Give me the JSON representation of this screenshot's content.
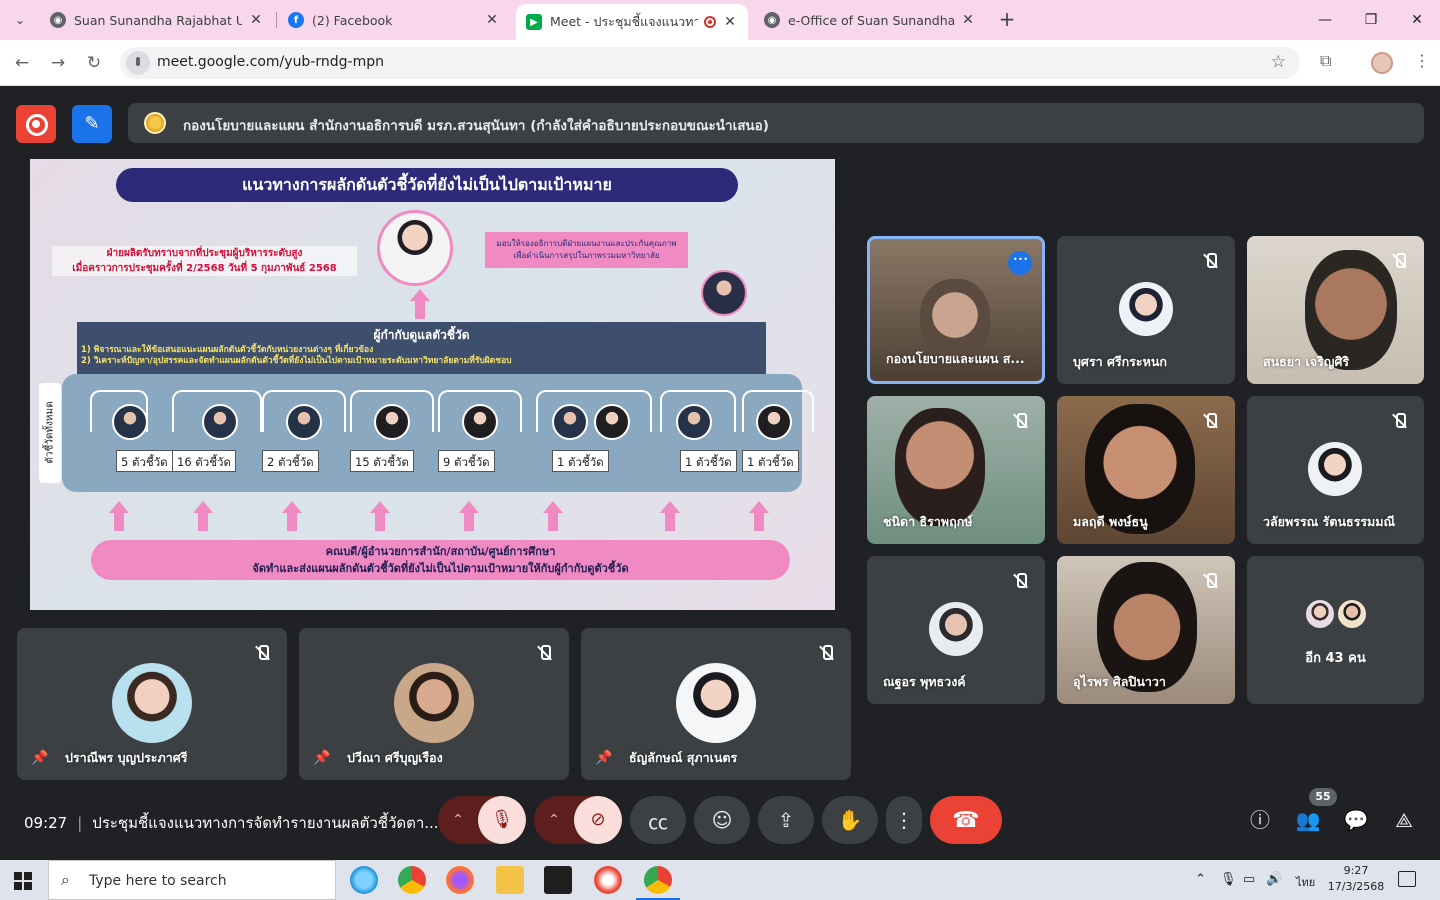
{
  "browser": {
    "tabs": [
      {
        "title": "Suan Sunandha Rajabhat Unive",
        "favicon_color": "#5f6368",
        "active": false
      },
      {
        "title": "(2) Facebook",
        "favicon_color": "#1877f2",
        "active": false
      },
      {
        "title": "Meet - ประชุมชี้แจงแนวทางการ",
        "favicon_color": "#00ac47",
        "active": true
      },
      {
        "title": "e-Office of Suan Sunandha Raja",
        "favicon_color": "#5f6368",
        "active": false
      }
    ],
    "url": "meet.google.com/yub-rndg-mpn"
  },
  "meet": {
    "presenter_banner": "กองนโยบายและแผน สำนักงานอธิการบดี มรภ.สวนสุนันทา (กำลังใส่คำอธิบายประกอบขณะนำเสนอ)",
    "slide": {
      "title": "แนวทางการผลักดันตัวชี้วัดที่ยังไม่เป็นไปตามเป้าหมาย",
      "red_note_1": "ฝ่ายผลิตรับทราบจากที่ประชุมผู้บริหารระดับสูง",
      "red_note_2": "เมื่อคราวการประชุมครั้งที่ 2/2568 วันที่ 5 กุมภาพันธ์ 2568",
      "pink_note_1": "มอบให้รองอธิการบดีฝ่ายแผนงานและประกันคุณภาพ",
      "pink_note_2": "เพื่อดำเนินการสรุปในภาพรวมมหาวิทยาลัย",
      "supervisor_title": "ผู้กำกับดูแลตัวชี้วัด",
      "supervisor_line_1": "1) พิจารณาและให้ข้อเสนอแนะแผนผลักดันตัวชี้วัดกับหน่วยงานต่างๆ ที่เกี่ยวข้อง",
      "supervisor_line_2": "2) วิเคราะห์ปัญหา/อุปสรรคและจัดทำแผนผลักดันตัวชี้วัดที่ยังไม่เป็นไปตามเป้าหมายระดับมหาวิทยาลัยตามที่รับผิดชอบ",
      "side_label": "ตัวชี้วัดทั้งหมด",
      "units": [
        "5 ตัวชี้วัด",
        "16 ตัวชี้วัด",
        "2 ตัวชี้วัด",
        "15 ตัวชี้วัด",
        "9 ตัวชี้วัด",
        "1 ตัวชี้วัด",
        "1 ตัวชี้วัด",
        "1 ตัวชี้วัด"
      ],
      "bottom_line_1": "คณบดี/ผู้อำนวยการสำนัก/สถาบัน/ศูนย์การศึกษา",
      "bottom_line_2": "จัดทำและส่งแผนผลักดันตัวชี้วัดที่ยังไม่เป็นไปตามเป้าหมายให้กับผู้กำกับดูตัวชี้วัด"
    },
    "pinned_tiles": [
      {
        "name": "ปราณีพร บุญประภาศรี",
        "muted": true
      },
      {
        "name": "ปวีณา ศรีบุญเรือง",
        "muted": true
      },
      {
        "name": "ธัญลักษณ์ สุภาเนตร",
        "muted": true
      }
    ],
    "grid_tiles": [
      {
        "name": "กองนโยบายและแผน ส...",
        "speaking": true,
        "video": true
      },
      {
        "name": "บุศรา ศรีกระหนก",
        "muted": true
      },
      {
        "name": "สนธยา เจริญศิริ",
        "muted": true,
        "video": true
      },
      {
        "name": "ชนิดา ธิราพฤกษ์",
        "muted": true,
        "video": true
      },
      {
        "name": "มลฤดี พงษ์ธนู",
        "muted": true,
        "video": true
      },
      {
        "name": "วลัยพรรณ รัตนธรรมมณี",
        "muted": true
      },
      {
        "name": "ณฐอร พุทธวงค์",
        "muted": true
      },
      {
        "name": "อุไรพร ศิลปินาวา",
        "muted": true,
        "video": true
      }
    ],
    "more_participants": "อีก 43 คน",
    "meeting_time": "09:27",
    "meeting_title": "ประชุมชี้แจงแนวทางการจัดทำรายงานผลตัวชี้วัดตา...",
    "participant_count": "55"
  },
  "taskbar": {
    "search_placeholder": "Type here to search",
    "language": "ไทย",
    "time": "9:27",
    "date": "17/3/2568"
  }
}
